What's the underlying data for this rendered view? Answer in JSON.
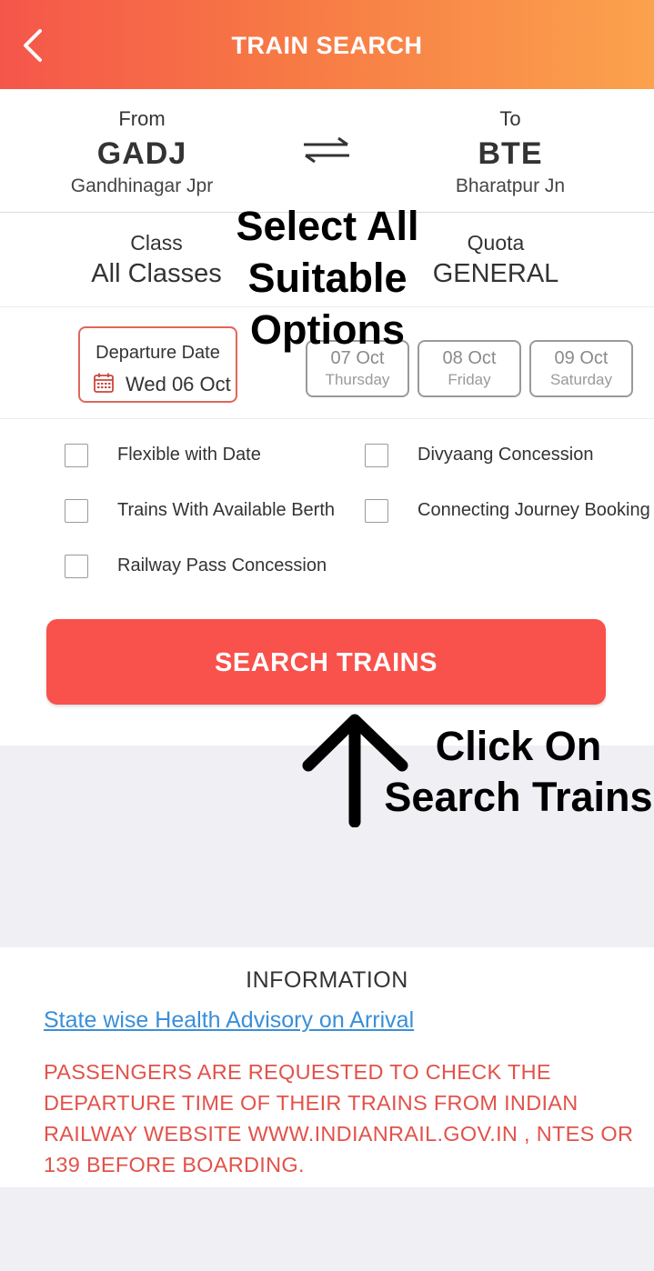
{
  "header": {
    "title": "TRAIN SEARCH",
    "back_icon": "chevron-left-icon"
  },
  "stations": {
    "from": {
      "label": "From",
      "code": "GADJ",
      "name": "Gandhinagar Jpr"
    },
    "to": {
      "label": "To",
      "code": "BTE",
      "name": "Bharatpur Jn"
    },
    "swap_icon": "swap-arrows-icon"
  },
  "class": {
    "label": "Class",
    "value": "All Classes"
  },
  "quota": {
    "label": "Quota",
    "value": "GENERAL"
  },
  "departure": {
    "label": "Departure Date",
    "value": "Wed 06 Oct",
    "icon": "calendar-icon"
  },
  "date_chips": [
    {
      "date": "07 Oct",
      "day": "Thursday"
    },
    {
      "date": "08 Oct",
      "day": "Friday"
    },
    {
      "date": "09 Oct",
      "day": "Saturday"
    }
  ],
  "options": [
    {
      "label": "Flexible with Date",
      "checked": false
    },
    {
      "label": "Divyaang Concession",
      "checked": false
    },
    {
      "label": "Trains With Available Berth",
      "checked": false
    },
    {
      "label": "Connecting Journey Booking",
      "checked": false
    },
    {
      "label": "Railway Pass Concession",
      "checked": false
    }
  ],
  "search_button": "SEARCH TRAINS",
  "information": {
    "heading": "INFORMATION",
    "link": "State wise Health Advisory on Arrival",
    "notice": "PASSENGERS ARE REQUESTED TO CHECK THE DEPARTURE TIME OF THEIR TRAINS FROM INDIAN RAILWAY WEBSITE WWW.INDIANRAIL.GOV.IN , NTES OR 139 BEFORE BOARDING."
  },
  "overlays": {
    "select_line1": "Select All",
    "select_line2": "Suitable",
    "select_line3": "Options",
    "click_line1": "Click On",
    "click_line2": "Search Trains"
  },
  "colors": {
    "accent": "#f9514b",
    "header_start": "#f5564a",
    "header_end": "#fba24d",
    "link": "#3a8fd8",
    "notice": "#e2524a"
  }
}
